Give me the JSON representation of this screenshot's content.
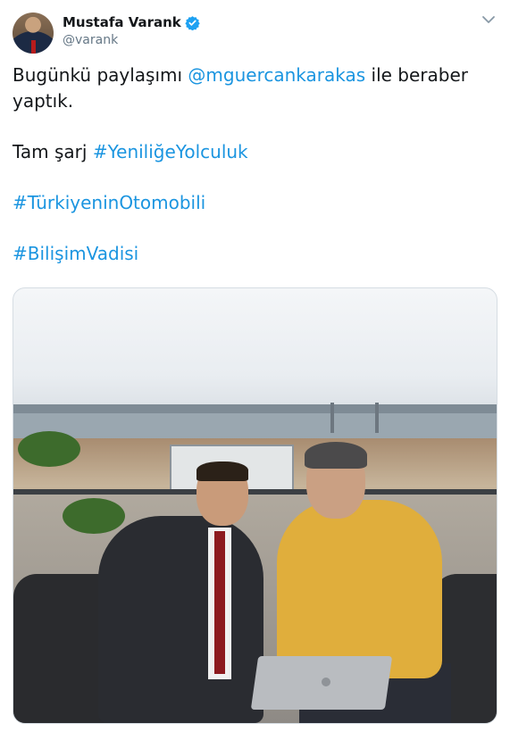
{
  "author": {
    "name": "Mustafa Varank",
    "handle": "@varank",
    "verified": true
  },
  "tweet": {
    "line1_prefix": "Bugünkü paylaşımı ",
    "mention": "@mguercankarakas",
    "line1_suffix": " ile beraber",
    "line2": "yaptık.",
    "line3_prefix": "Tam şarj ",
    "hashtag1": "#YeniliğeYolculuk",
    "hashtag2": "#TürkiyeninOtomobili",
    "hashtag3": "#BilişimVadisi"
  },
  "colors": {
    "link": "#1b95e0",
    "verified_badge": "#1da1f2",
    "text": "#14171a",
    "secondary_text": "#657786"
  },
  "icons": {
    "verified": "verified-badge-icon",
    "menu": "chevron-down-icon"
  }
}
